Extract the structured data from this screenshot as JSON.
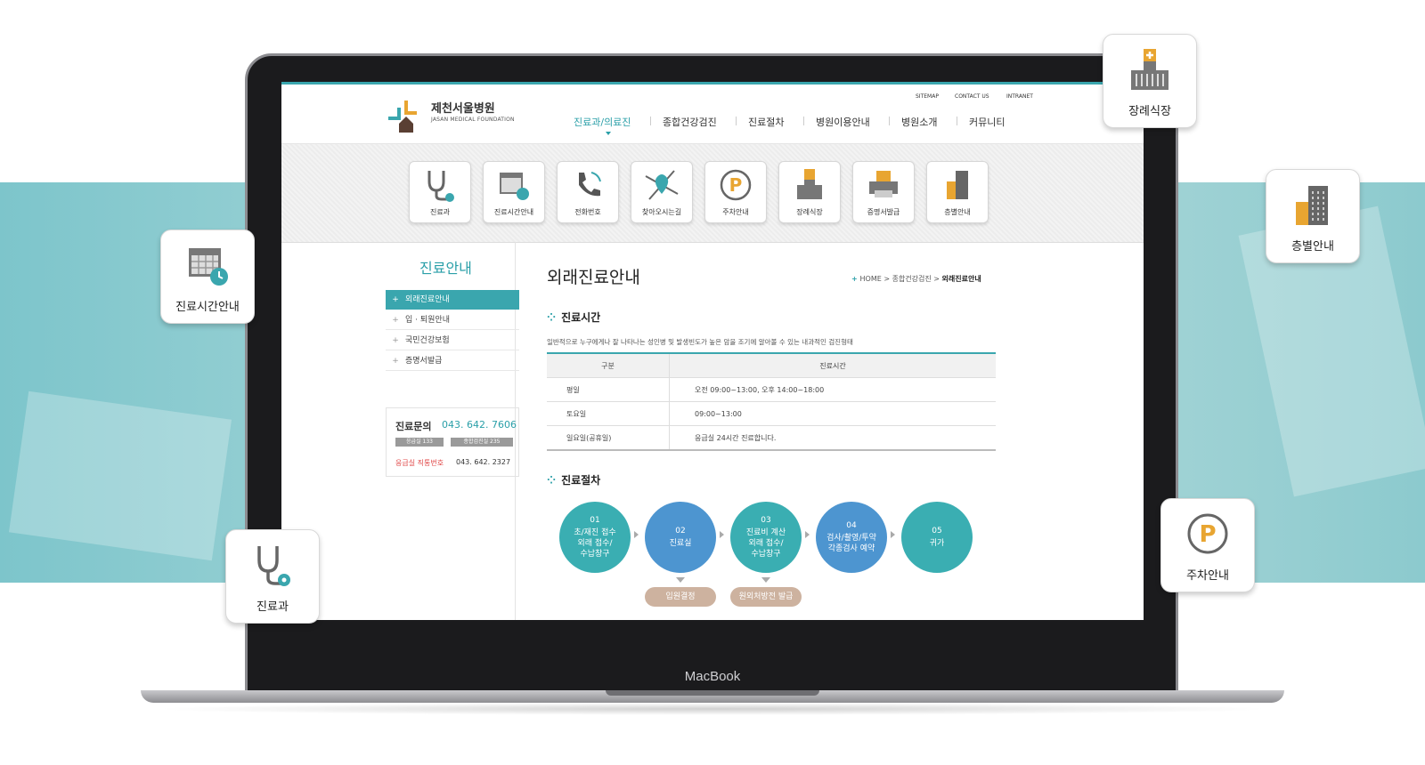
{
  "site": {
    "name": "제천서울병원",
    "subtitle": "JASAN MEDICAL FOUNDATION"
  },
  "utility_links": [
    "SITEMAP",
    "CONTACT US",
    "INTRANET"
  ],
  "nav": [
    "진료과/의료진",
    "종합건강검진",
    "진료절차",
    "병원이용안내",
    "병원소개",
    "커뮤니티"
  ],
  "quick_menu": [
    "진료과",
    "진료시간안내",
    "전화번호",
    "찾아오시는길",
    "주차안내",
    "장례식장",
    "증명서발급",
    "층별안내"
  ],
  "sidebar": {
    "title": "진료안내",
    "items": [
      "외래진료안내",
      "입 · 퇴원안내",
      "국민건강보험",
      "증명서발급"
    ]
  },
  "contact": {
    "label": "진료문의",
    "number": "043. 642. 7606",
    "tag1": "응급실 133",
    "tag2": "종합검진실 235",
    "emergency_label": "응급실 직통번호",
    "emergency_number": "043. 642. 2327"
  },
  "main": {
    "title": "외래진료안내",
    "breadcrumb": {
      "home": "HOME",
      "level1": "종합건강검진",
      "current": "외래진료안내"
    },
    "section1": "진료시간",
    "desc": "일반적으로 누구에게나 잘 나타나는 성인병 및 발생빈도가 높은 암을 조기에 알아볼 수 있는 내과적인 검진형태",
    "table": {
      "headers": [
        "구분",
        "진료시간"
      ],
      "rows": [
        [
          "평일",
          "오전 09:00~13:00,  오후 14:00~18:00"
        ],
        [
          "토요일",
          "09:00~13:00"
        ],
        [
          "일요일(공휴일)",
          "응급실 24시간 진료합니다."
        ]
      ]
    },
    "section2": "진료절차",
    "steps": [
      {
        "n": "01",
        "l1": "초/재진 접수",
        "l2": "외래 접수/",
        "l3": "수납창구"
      },
      {
        "n": "02",
        "l1": "진료실",
        "l2": "",
        "l3": ""
      },
      {
        "n": "03",
        "l1": "진료비 계산",
        "l2": "외래 접수/",
        "l3": "수납창구"
      },
      {
        "n": "04",
        "l1": "검사/촬영/투약",
        "l2": "각종검사 예약",
        "l3": ""
      },
      {
        "n": "05",
        "l1": "귀가",
        "l2": "",
        "l3": ""
      }
    ],
    "pills": [
      "입원결정",
      "원외처방전 발급"
    ]
  },
  "floating_cards": [
    "장례식장",
    "층별안내",
    "진료시간안내",
    "주차안내",
    "진료과"
  ],
  "device_label": "MacBook",
  "colors": {
    "accent": "#3aa6ae",
    "step_teal": "#3aaeb2",
    "step_blue": "#4d95d0",
    "pill": "#cdb29f",
    "emergency": "#e04848"
  }
}
